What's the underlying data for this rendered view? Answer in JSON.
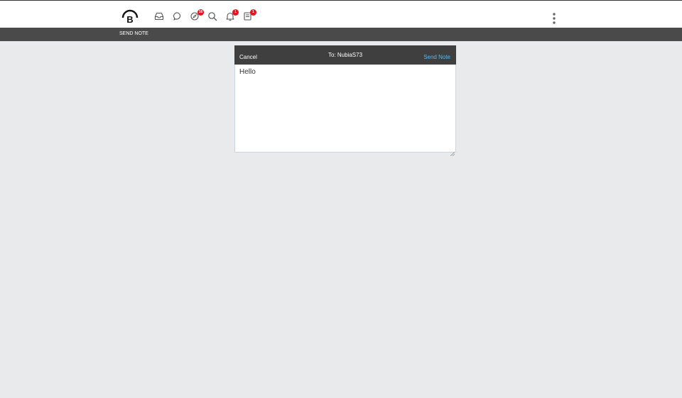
{
  "header": {
    "logo_text": "B",
    "icons": [
      {
        "name": "inbox-icon",
        "badge": ""
      },
      {
        "name": "chat-icon",
        "badge": ""
      },
      {
        "name": "compass-icon",
        "badge": "16"
      },
      {
        "name": "search-icon",
        "badge": ""
      },
      {
        "name": "bell-icon",
        "badge": "1"
      },
      {
        "name": "notebook-icon",
        "badge": "1"
      }
    ],
    "menu_icon": "kebab-menu-icon"
  },
  "subheader": {
    "title": "SEND NOTE"
  },
  "dialog": {
    "cancel_label": "Cancel",
    "recipient": "To: NubiaS73",
    "send_label": "Send Note",
    "note_text": "Hello"
  },
  "colors": {
    "badge": "#e8141d",
    "link": "#58b9ef",
    "header_dark": "#3f3f3f",
    "background": "#e9eaec"
  }
}
